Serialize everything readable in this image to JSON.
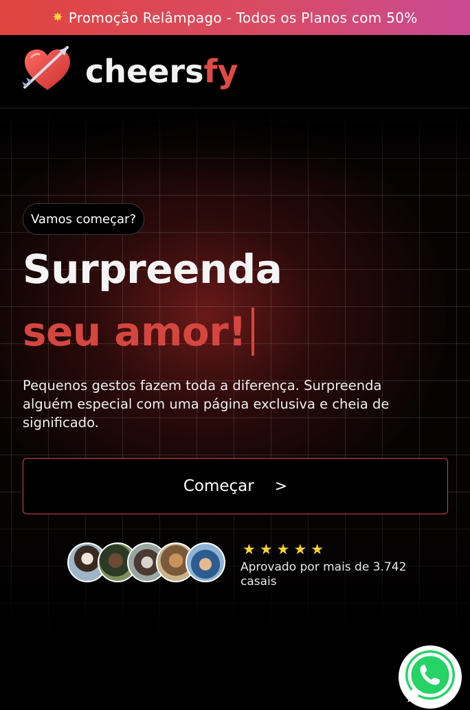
{
  "promo": {
    "icon": "sparkle-icon",
    "text": "Promoção Relâmpago - Todos os Planos com 50%"
  },
  "header": {
    "logo_part1": "cheers",
    "logo_part2": "fy",
    "logo_icon": "heart-arrow-icon"
  },
  "hero": {
    "pill": "Vamos começar?",
    "headline_1": "Surpreenda",
    "headline_2": "seu amor!",
    "subtext": "Pequenos gestos fazem toda a diferença. Surpreenda alguém especial com uma página exclusiva e cheia de significado.",
    "cta_label": "Começar",
    "cta_chevron": ">"
  },
  "social_proof": {
    "stars": "★★★★★",
    "rating_value": 5,
    "approved_text": "Aprovado por mais de 3.742 casais",
    "avatar_count": 5
  },
  "colors": {
    "accent": "#d64640",
    "promo_gradient_start": "#e0443f",
    "promo_gradient_end": "#c94a93",
    "star": "#ffd230",
    "whatsapp": "#25d366"
  },
  "floating": {
    "icon": "whatsapp-icon"
  }
}
